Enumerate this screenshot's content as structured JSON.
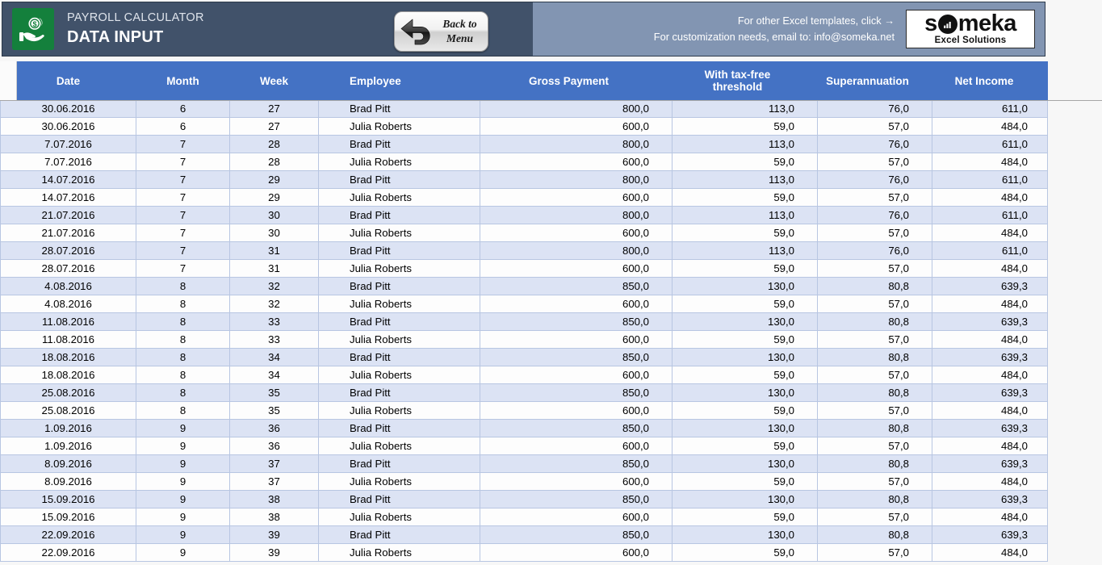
{
  "header": {
    "logo_icon": "money-hand-icon",
    "subtitle": "PAYROLL CALCULATOR",
    "title": "DATA INPUT",
    "back_button": {
      "line1": "Back to",
      "line2": "Menu",
      "icon": "back-arrow-icon"
    },
    "promo_line1": "For other Excel templates, click →",
    "promo_line2": "For customization needs, email to: info@someka.net",
    "brand": {
      "word": "s",
      "word_mid": "meka",
      "chart_icon": "bar-chart-icon",
      "tagline": "Excel Solutions"
    },
    "colors": {
      "banner_dark": "#41526a",
      "banner_light": "#8295b2",
      "logo_green": "#14803c",
      "table_header_blue": "#4472c4",
      "row_alt_blue": "#dce3f4"
    }
  },
  "table": {
    "columns": [
      {
        "key": "date",
        "label": "Date"
      },
      {
        "key": "month",
        "label": "Month"
      },
      {
        "key": "week",
        "label": "Week"
      },
      {
        "key": "employee",
        "label": "Employee"
      },
      {
        "key": "gross",
        "label": "Gross Payment"
      },
      {
        "key": "threshold",
        "label": "With tax-free threshold"
      },
      {
        "key": "super",
        "label": "Superannuation"
      },
      {
        "key": "net",
        "label": "Net Income"
      }
    ],
    "rows": [
      [
        "30.06.2016",
        "6",
        "27",
        "Brad Pitt",
        "800,0",
        "113,0",
        "76,0",
        "611,0"
      ],
      [
        "30.06.2016",
        "6",
        "27",
        "Julia Roberts",
        "600,0",
        "59,0",
        "57,0",
        "484,0"
      ],
      [
        "7.07.2016",
        "7",
        "28",
        "Brad Pitt",
        "800,0",
        "113,0",
        "76,0",
        "611,0"
      ],
      [
        "7.07.2016",
        "7",
        "28",
        "Julia Roberts",
        "600,0",
        "59,0",
        "57,0",
        "484,0"
      ],
      [
        "14.07.2016",
        "7",
        "29",
        "Brad Pitt",
        "800,0",
        "113,0",
        "76,0",
        "611,0"
      ],
      [
        "14.07.2016",
        "7",
        "29",
        "Julia Roberts",
        "600,0",
        "59,0",
        "57,0",
        "484,0"
      ],
      [
        "21.07.2016",
        "7",
        "30",
        "Brad Pitt",
        "800,0",
        "113,0",
        "76,0",
        "611,0"
      ],
      [
        "21.07.2016",
        "7",
        "30",
        "Julia Roberts",
        "600,0",
        "59,0",
        "57,0",
        "484,0"
      ],
      [
        "28.07.2016",
        "7",
        "31",
        "Brad Pitt",
        "800,0",
        "113,0",
        "76,0",
        "611,0"
      ],
      [
        "28.07.2016",
        "7",
        "31",
        "Julia Roberts",
        "600,0",
        "59,0",
        "57,0",
        "484,0"
      ],
      [
        "4.08.2016",
        "8",
        "32",
        "Brad Pitt",
        "850,0",
        "130,0",
        "80,8",
        "639,3"
      ],
      [
        "4.08.2016",
        "8",
        "32",
        "Julia Roberts",
        "600,0",
        "59,0",
        "57,0",
        "484,0"
      ],
      [
        "11.08.2016",
        "8",
        "33",
        "Brad Pitt",
        "850,0",
        "130,0",
        "80,8",
        "639,3"
      ],
      [
        "11.08.2016",
        "8",
        "33",
        "Julia Roberts",
        "600,0",
        "59,0",
        "57,0",
        "484,0"
      ],
      [
        "18.08.2016",
        "8",
        "34",
        "Brad Pitt",
        "850,0",
        "130,0",
        "80,8",
        "639,3"
      ],
      [
        "18.08.2016",
        "8",
        "34",
        "Julia Roberts",
        "600,0",
        "59,0",
        "57,0",
        "484,0"
      ],
      [
        "25.08.2016",
        "8",
        "35",
        "Brad Pitt",
        "850,0",
        "130,0",
        "80,8",
        "639,3"
      ],
      [
        "25.08.2016",
        "8",
        "35",
        "Julia Roberts",
        "600,0",
        "59,0",
        "57,0",
        "484,0"
      ],
      [
        "1.09.2016",
        "9",
        "36",
        "Brad Pitt",
        "850,0",
        "130,0",
        "80,8",
        "639,3"
      ],
      [
        "1.09.2016",
        "9",
        "36",
        "Julia Roberts",
        "600,0",
        "59,0",
        "57,0",
        "484,0"
      ],
      [
        "8.09.2016",
        "9",
        "37",
        "Brad Pitt",
        "850,0",
        "130,0",
        "80,8",
        "639,3"
      ],
      [
        "8.09.2016",
        "9",
        "37",
        "Julia Roberts",
        "600,0",
        "59,0",
        "57,0",
        "484,0"
      ],
      [
        "15.09.2016",
        "9",
        "38",
        "Brad Pitt",
        "850,0",
        "130,0",
        "80,8",
        "639,3"
      ],
      [
        "15.09.2016",
        "9",
        "38",
        "Julia Roberts",
        "600,0",
        "59,0",
        "57,0",
        "484,0"
      ],
      [
        "22.09.2016",
        "9",
        "39",
        "Brad Pitt",
        "850,0",
        "130,0",
        "80,8",
        "639,3"
      ],
      [
        "22.09.2016",
        "9",
        "39",
        "Julia Roberts",
        "600,0",
        "59,0",
        "57,0",
        "484,0"
      ]
    ]
  }
}
